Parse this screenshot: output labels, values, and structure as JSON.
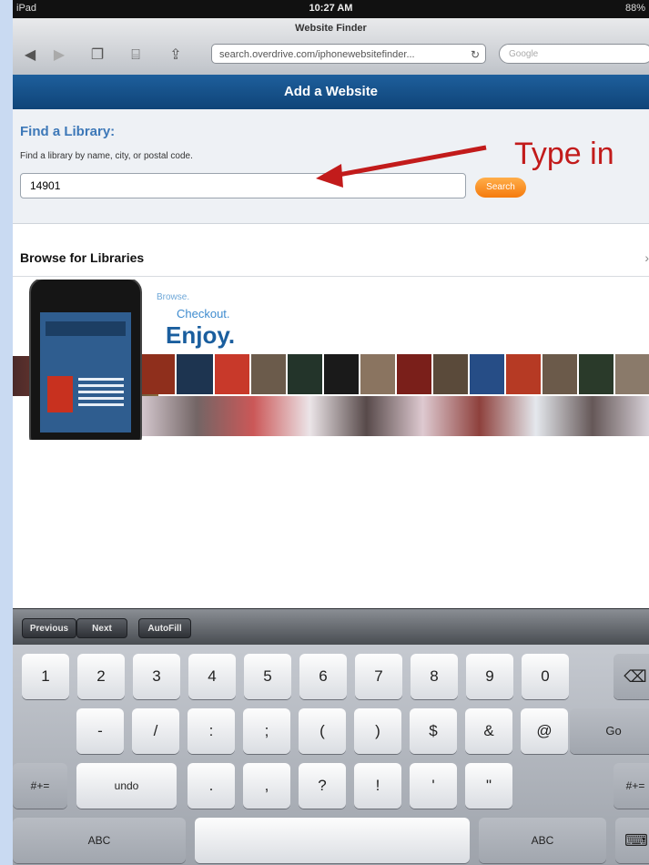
{
  "status_bar": {
    "carrier": "iPad",
    "time": "10:27 AM",
    "battery": "88%"
  },
  "browser": {
    "page_title": "Website Finder",
    "url": "search.overdrive.com/iphonewebsitefinder...",
    "search_placeholder": "Google",
    "icons": {
      "back": "back-arrow-icon",
      "forward": "forward-arrow-icon",
      "tabs": "tabs-icon",
      "bookmarks": "bookmarks-icon",
      "share": "share-icon",
      "reload": "reload-icon"
    }
  },
  "header": {
    "title": "Add a Website"
  },
  "find": {
    "heading": "Find a Library:",
    "instructions": "Find a library by name, city, or postal code.",
    "input_value": "14901",
    "search_label": "Search"
  },
  "annotation": {
    "text": "Type in"
  },
  "browse": {
    "label": "Browse for Libraries",
    "chevron": "›"
  },
  "promo": {
    "browse": "Browse.",
    "checkout": "Checkout.",
    "enjoy": "Enjoy."
  },
  "form_toolbar": {
    "previous": "Previous",
    "next": "Next",
    "autofill": "AutoFill"
  },
  "keyboard": {
    "row1": [
      "1",
      "2",
      "3",
      "4",
      "5",
      "6",
      "7",
      "8",
      "9",
      "0"
    ],
    "row1_delete": "⌫",
    "row2": [
      "-",
      "/",
      ":",
      ";",
      "(",
      ")",
      "$",
      "&",
      "@"
    ],
    "row2_go": "Go",
    "row3_left": "#+=",
    "row3_undo": "undo",
    "row3": [
      ".",
      ",",
      "?",
      "!",
      "'",
      "\""
    ],
    "row3_right": "#+=",
    "row4_abc_left": "ABC",
    "row4_abc_right": "ABC",
    "row4_hide": "⌨"
  },
  "colors": {
    "header": "#1a5a96",
    "accent_orange": "#f57a0c",
    "annotation_red": "#c21b1b",
    "heading_blue": "#3d78b8"
  }
}
